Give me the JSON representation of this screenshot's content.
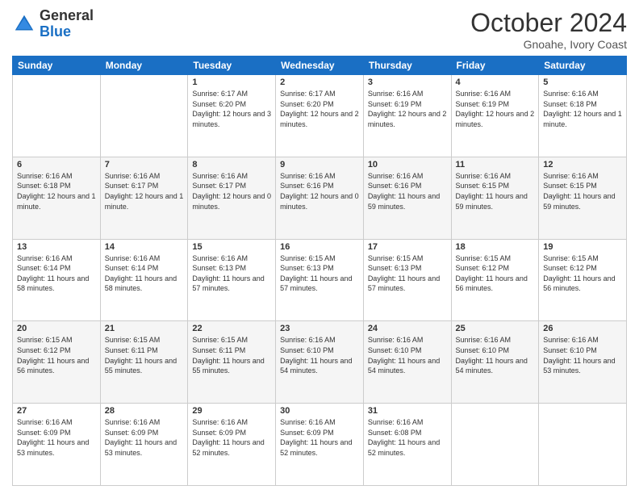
{
  "header": {
    "logo_general": "General",
    "logo_blue": "Blue",
    "month": "October 2024",
    "location": "Gnoahe, Ivory Coast"
  },
  "days_of_week": [
    "Sunday",
    "Monday",
    "Tuesday",
    "Wednesday",
    "Thursday",
    "Friday",
    "Saturday"
  ],
  "weeks": [
    [
      {
        "day": "",
        "content": ""
      },
      {
        "day": "",
        "content": ""
      },
      {
        "day": "1",
        "content": "Sunrise: 6:17 AM\nSunset: 6:20 PM\nDaylight: 12 hours and 3 minutes."
      },
      {
        "day": "2",
        "content": "Sunrise: 6:17 AM\nSunset: 6:20 PM\nDaylight: 12 hours and 2 minutes."
      },
      {
        "day": "3",
        "content": "Sunrise: 6:16 AM\nSunset: 6:19 PM\nDaylight: 12 hours and 2 minutes."
      },
      {
        "day": "4",
        "content": "Sunrise: 6:16 AM\nSunset: 6:19 PM\nDaylight: 12 hours and 2 minutes."
      },
      {
        "day": "5",
        "content": "Sunrise: 6:16 AM\nSunset: 6:18 PM\nDaylight: 12 hours and 1 minute."
      }
    ],
    [
      {
        "day": "6",
        "content": "Sunrise: 6:16 AM\nSunset: 6:18 PM\nDaylight: 12 hours and 1 minute."
      },
      {
        "day": "7",
        "content": "Sunrise: 6:16 AM\nSunset: 6:17 PM\nDaylight: 12 hours and 1 minute."
      },
      {
        "day": "8",
        "content": "Sunrise: 6:16 AM\nSunset: 6:17 PM\nDaylight: 12 hours and 0 minutes."
      },
      {
        "day": "9",
        "content": "Sunrise: 6:16 AM\nSunset: 6:16 PM\nDaylight: 12 hours and 0 minutes."
      },
      {
        "day": "10",
        "content": "Sunrise: 6:16 AM\nSunset: 6:16 PM\nDaylight: 11 hours and 59 minutes."
      },
      {
        "day": "11",
        "content": "Sunrise: 6:16 AM\nSunset: 6:15 PM\nDaylight: 11 hours and 59 minutes."
      },
      {
        "day": "12",
        "content": "Sunrise: 6:16 AM\nSunset: 6:15 PM\nDaylight: 11 hours and 59 minutes."
      }
    ],
    [
      {
        "day": "13",
        "content": "Sunrise: 6:16 AM\nSunset: 6:14 PM\nDaylight: 11 hours and 58 minutes."
      },
      {
        "day": "14",
        "content": "Sunrise: 6:16 AM\nSunset: 6:14 PM\nDaylight: 11 hours and 58 minutes."
      },
      {
        "day": "15",
        "content": "Sunrise: 6:16 AM\nSunset: 6:13 PM\nDaylight: 11 hours and 57 minutes."
      },
      {
        "day": "16",
        "content": "Sunrise: 6:15 AM\nSunset: 6:13 PM\nDaylight: 11 hours and 57 minutes."
      },
      {
        "day": "17",
        "content": "Sunrise: 6:15 AM\nSunset: 6:13 PM\nDaylight: 11 hours and 57 minutes."
      },
      {
        "day": "18",
        "content": "Sunrise: 6:15 AM\nSunset: 6:12 PM\nDaylight: 11 hours and 56 minutes."
      },
      {
        "day": "19",
        "content": "Sunrise: 6:15 AM\nSunset: 6:12 PM\nDaylight: 11 hours and 56 minutes."
      }
    ],
    [
      {
        "day": "20",
        "content": "Sunrise: 6:15 AM\nSunset: 6:12 PM\nDaylight: 11 hours and 56 minutes."
      },
      {
        "day": "21",
        "content": "Sunrise: 6:15 AM\nSunset: 6:11 PM\nDaylight: 11 hours and 55 minutes."
      },
      {
        "day": "22",
        "content": "Sunrise: 6:15 AM\nSunset: 6:11 PM\nDaylight: 11 hours and 55 minutes."
      },
      {
        "day": "23",
        "content": "Sunrise: 6:16 AM\nSunset: 6:10 PM\nDaylight: 11 hours and 54 minutes."
      },
      {
        "day": "24",
        "content": "Sunrise: 6:16 AM\nSunset: 6:10 PM\nDaylight: 11 hours and 54 minutes."
      },
      {
        "day": "25",
        "content": "Sunrise: 6:16 AM\nSunset: 6:10 PM\nDaylight: 11 hours and 54 minutes."
      },
      {
        "day": "26",
        "content": "Sunrise: 6:16 AM\nSunset: 6:10 PM\nDaylight: 11 hours and 53 minutes."
      }
    ],
    [
      {
        "day": "27",
        "content": "Sunrise: 6:16 AM\nSunset: 6:09 PM\nDaylight: 11 hours and 53 minutes."
      },
      {
        "day": "28",
        "content": "Sunrise: 6:16 AM\nSunset: 6:09 PM\nDaylight: 11 hours and 53 minutes."
      },
      {
        "day": "29",
        "content": "Sunrise: 6:16 AM\nSunset: 6:09 PM\nDaylight: 11 hours and 52 minutes."
      },
      {
        "day": "30",
        "content": "Sunrise: 6:16 AM\nSunset: 6:09 PM\nDaylight: 11 hours and 52 minutes."
      },
      {
        "day": "31",
        "content": "Sunrise: 6:16 AM\nSunset: 6:08 PM\nDaylight: 11 hours and 52 minutes."
      },
      {
        "day": "",
        "content": ""
      },
      {
        "day": "",
        "content": ""
      }
    ]
  ]
}
